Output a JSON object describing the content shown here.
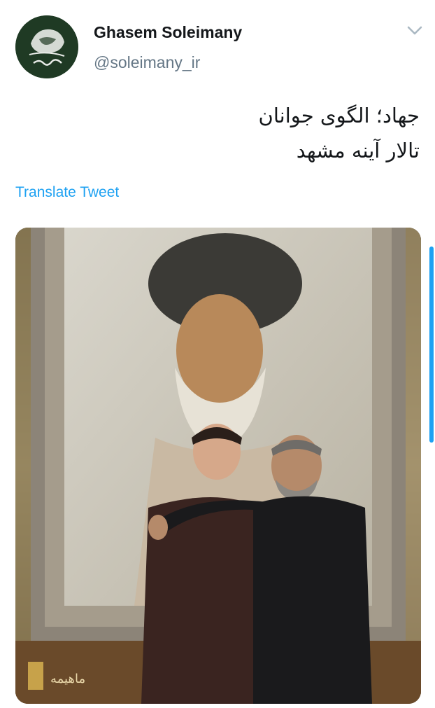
{
  "tweet": {
    "author_name": "Ghasem Soleimany",
    "author_handle": "@soleimany_ir",
    "avatar_icon": "profile-avatar-emblem",
    "menu_icon": "chevron-down-icon",
    "text_lines": [
      "جهاد؛ الگوی جوانان",
      "تالار آینه مشهد"
    ],
    "translate_label": "Translate Tweet",
    "media_icon": "photo-image"
  },
  "colors": {
    "link": "#1da1f2",
    "name": "#14171a",
    "handle": "#657786",
    "avatar_bg": "#1f3a24"
  }
}
